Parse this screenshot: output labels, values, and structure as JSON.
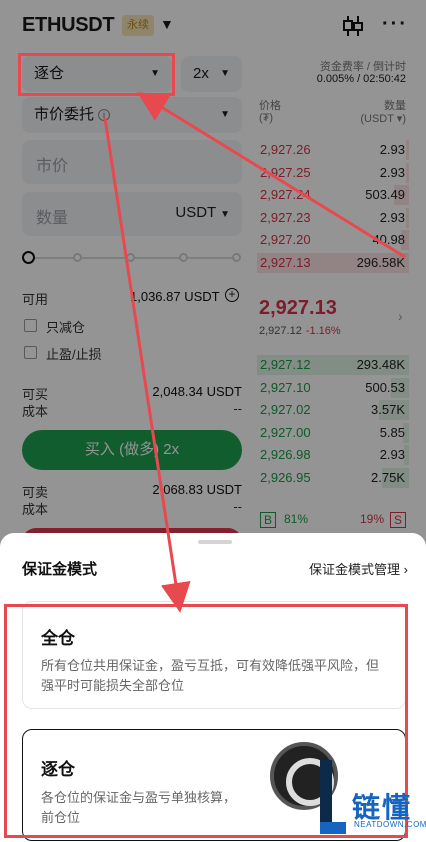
{
  "header": {
    "pair": "ETHUSDT",
    "badge": "永续",
    "candle_icon": "candlestick-icon",
    "more_icon": "more-icon"
  },
  "form": {
    "margin_mode": "逐仓",
    "leverage": "2x",
    "order_type": "市价委托",
    "price_placeholder": "市价",
    "qty_placeholder": "数量",
    "qty_unit": "USDT",
    "available_label": "可用",
    "available_value": "1,036.87 USDT",
    "reduce_only": "只减仓",
    "tp_sl": "止盈/止损",
    "can_buy_label": "可买",
    "can_buy_value": "2,048.34 USDT",
    "cost_label": "成本",
    "cost_value_buy": "--",
    "buy_button": "买入 (做多) 2x",
    "can_sell_label": "可卖",
    "can_sell_value": "2,068.83 USDT",
    "cost_value_sell": "--",
    "slider_position": 0
  },
  "orderbook": {
    "funding_label": "资金费率 / 倒计时",
    "funding_value": "0.005% / 02:50:42",
    "price_header": "价格",
    "price_unit": "(₮)",
    "qty_header": "数量",
    "qty_unit": "(USDT ▾)",
    "asks": [
      {
        "price": "2,927.26",
        "qty": "2.93",
        "depth": 0.02
      },
      {
        "price": "2,927.25",
        "qty": "2.93",
        "depth": 0.02
      },
      {
        "price": "2,927.24",
        "qty": "503.49",
        "depth": 0.1
      },
      {
        "price": "2,927.23",
        "qty": "2.93",
        "depth": 0.02
      },
      {
        "price": "2,927.20",
        "qty": "40.98",
        "depth": 0.05
      },
      {
        "price": "2,927.13",
        "qty": "296.58K",
        "depth": 1.0
      }
    ],
    "last_price": "2,927.13",
    "mark_price": "2,927.12",
    "change": "-1.16%",
    "bids": [
      {
        "price": "2,927.12",
        "qty": "293.48K",
        "depth": 1.0
      },
      {
        "price": "2,927.10",
        "qty": "500.53",
        "depth": 0.12
      },
      {
        "price": "2,927.02",
        "qty": "3.57K",
        "depth": 0.2
      },
      {
        "price": "2,927.00",
        "qty": "5.85",
        "depth": 0.04
      },
      {
        "price": "2,926.98",
        "qty": "2.93",
        "depth": 0.03
      },
      {
        "price": "2,926.95",
        "qty": "2.75K",
        "depth": 0.18
      }
    ],
    "buy_ratio_label": "B",
    "buy_ratio": "81%",
    "sell_ratio": "19%",
    "sell_ratio_label": "S"
  },
  "sheet": {
    "title": "保证金模式",
    "manage_link": "保证金模式管理",
    "options": [
      {
        "title": "全仓",
        "desc": "所有仓位共用保证金，盈亏互抵，可有效降低强平风险，但强平时可能损失全部仓位"
      },
      {
        "title": "逐仓",
        "desc": "各仓位的保证金与盈亏单独核算，",
        "desc2": "前仓位"
      }
    ]
  },
  "watermark": {
    "text": "链懂",
    "sub": "NEATDOWN.COM"
  },
  "colors": {
    "buy": "#1fa050",
    "sell": "#d8334a",
    "annotation": "#e8494f"
  }
}
